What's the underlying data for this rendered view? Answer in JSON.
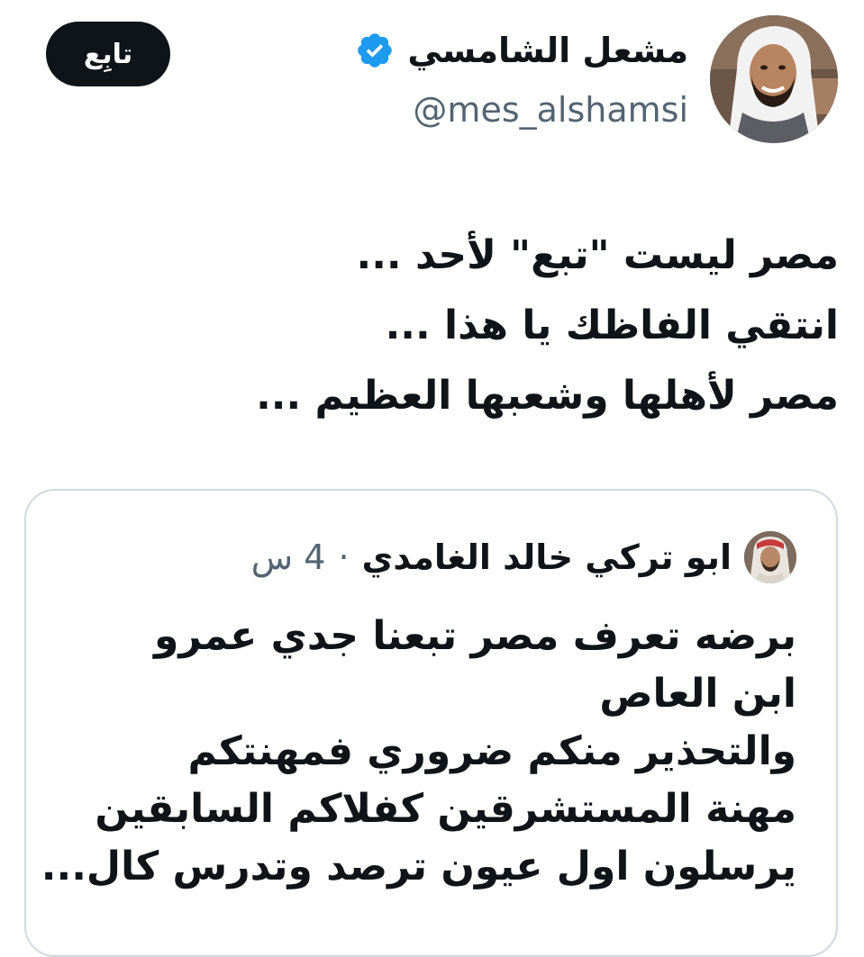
{
  "author": {
    "name": "مشعل الشامسي",
    "handle": "@mes_alshamsi",
    "verified_icon": "verified-badge-icon",
    "verified_color": "#1d9bf0"
  },
  "follow_button": {
    "label": "تابِع"
  },
  "tweet": {
    "lines": [
      "مصر ليست \"تبع\" لأحد ...",
      "انتقي الفاظك يا هذا ...",
      "مصر لأهلها وشعبها العظيم ..."
    ]
  },
  "quoted_tweet": {
    "author_name": "ابو تركي خالد الغامدي",
    "separator": "·",
    "time": "4 س",
    "lines": [
      "برضه تعرف مصر تبعنا جدي عمرو",
      "ابن العاص",
      "والتحذير منكم ضروري فمهنتكم",
      "مهنة المستشرقين كفلاكم السابقين",
      "يرسلون اول عيون ترصد وتدرس كال..."
    ]
  },
  "colors": {
    "text": "#0f1419",
    "muted": "#536471",
    "border": "#cfd9de",
    "button_bg": "#0f1419",
    "button_text": "#ffffff"
  }
}
